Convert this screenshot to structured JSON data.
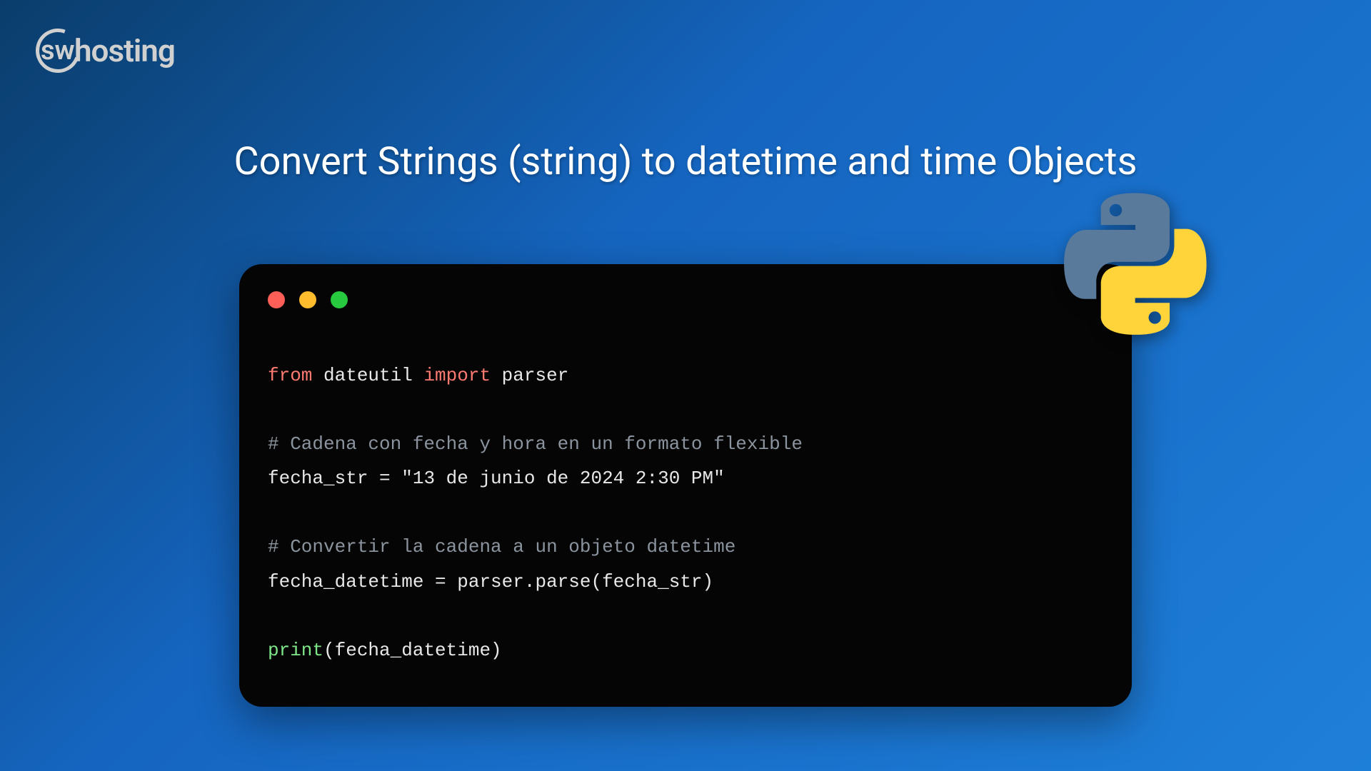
{
  "logo": {
    "circle_text": "sw",
    "text": "hosting"
  },
  "title": "Convert Strings (string) to datetime and time Objects",
  "code": {
    "line1": {
      "from": "from",
      "module": " dateutil ",
      "import": "import",
      "item": " parser"
    },
    "line2": "# Cadena con fecha y hora en un formato flexible",
    "line3": {
      "var": "fecha_str = ",
      "value": "\"13 de junio de 2024 2:30 PM\""
    },
    "line4": "# Convertir la cadena a un objeto datetime",
    "line5": "fecha_datetime = parser.parse(fecha_str)",
    "line6": {
      "func": "print",
      "args": "(fecha_datetime)"
    }
  }
}
